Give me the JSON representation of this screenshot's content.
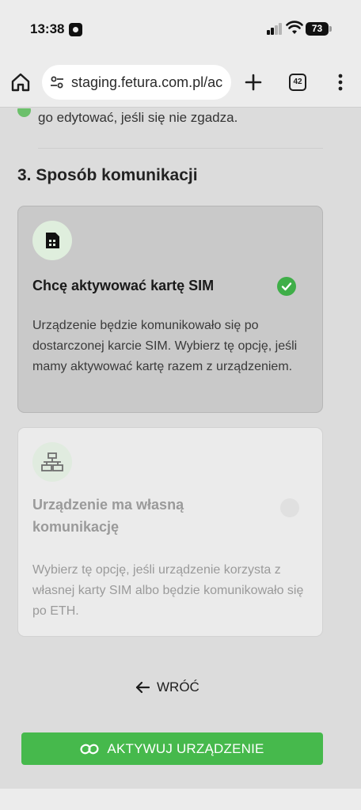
{
  "status_bar": {
    "time": "13:38",
    "battery": "73"
  },
  "browser": {
    "url": "staging.fetura.com.pl/ac",
    "tab_count": "42"
  },
  "page": {
    "previous_text": "go edytować, jeśli się nie zgadza.",
    "section_title": "3. Sposób komunikacji",
    "options": [
      {
        "title": "Chcę aktywować kartę SIM",
        "description": "Urządzenie będzie komunikowało się po dostarczonej karcie SIM. Wybierz tę opcję, jeśli mamy aktywować kartę razem z urządzeniem.",
        "selected": true
      },
      {
        "title": "Urządzenie ma własną komunikację",
        "description": "Wybierz tę opcję, jeśli urządzenie korzysta z własnej karty SIM albo będzie komunikowało się po ETH.",
        "selected": false
      }
    ],
    "back_label": "WRÓĆ",
    "activate_label": "AKTYWUJ URZĄDZENIE"
  },
  "colors": {
    "accent_green": "#46b94c",
    "selected_card": "#c9c9c9"
  }
}
